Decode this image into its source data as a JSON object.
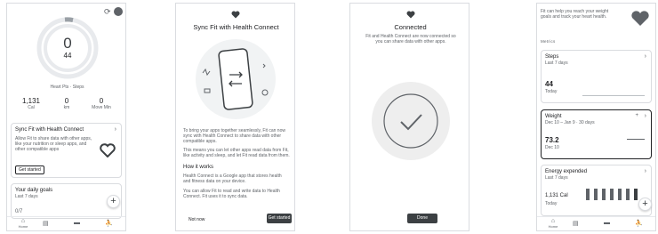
{
  "screen1": {
    "ring": {
      "points": "0",
      "steps": "44"
    },
    "legend": "Heart Pts · Steps",
    "stats": [
      {
        "value": "1,131",
        "label": "Cal"
      },
      {
        "value": "0",
        "label": "km"
      },
      {
        "value": "0",
        "label": "Move Min"
      }
    ],
    "sync_card": {
      "title": "Sync Fit with Health Connect",
      "body": "Allow Fit to share data with other apps, like your nutrition or sleep apps, and other compatible apps",
      "button": "Get started"
    },
    "goals_card": {
      "title": "Your daily goals",
      "subtitle": "Last 7 days",
      "value": "0/7"
    },
    "nav": [
      "Home",
      "Journal",
      "Browse",
      "Profile"
    ]
  },
  "screen2": {
    "title": "Sync Fit with Health Connect",
    "para1": "To bring your apps together seamlessly, Fit can now sync with Health Connect to share data with other compatible apps.",
    "para2": "This means you can let other apps read data from Fit, like activity and sleep, and let Fit read data from them.",
    "how_heading": "How it works",
    "para3": "Health Connect is a Google app that stores health and fitness data on your device.",
    "para4": "You can allow Fit to read and write data to Health Connect. Fit uses it to sync data.",
    "not_now": "Not now",
    "get_started": "Get started"
  },
  "screen3": {
    "title": "Connected",
    "body": "Fit and Health Connect are now connected so you can share data with other apps.",
    "done": "Done"
  },
  "screen4": {
    "top_text": "Fit can help you reach your weight goals and track your heart health.",
    "section": "Metrics",
    "cards": [
      {
        "title": "Steps",
        "subtitle": "Last 7 days",
        "value": "44",
        "sub": "Today"
      },
      {
        "title": "Weight",
        "subtitle": "Dec 10 – Jan 9 · 30 days",
        "value": "73.2",
        "sub": "Dec 10"
      },
      {
        "title": "Energy expended",
        "subtitle": "Last 7 days",
        "value": "1,131 Cal",
        "sub": "Today"
      }
    ],
    "nav": [
      "Home",
      "Journal",
      "Browse",
      "Profile"
    ]
  }
}
